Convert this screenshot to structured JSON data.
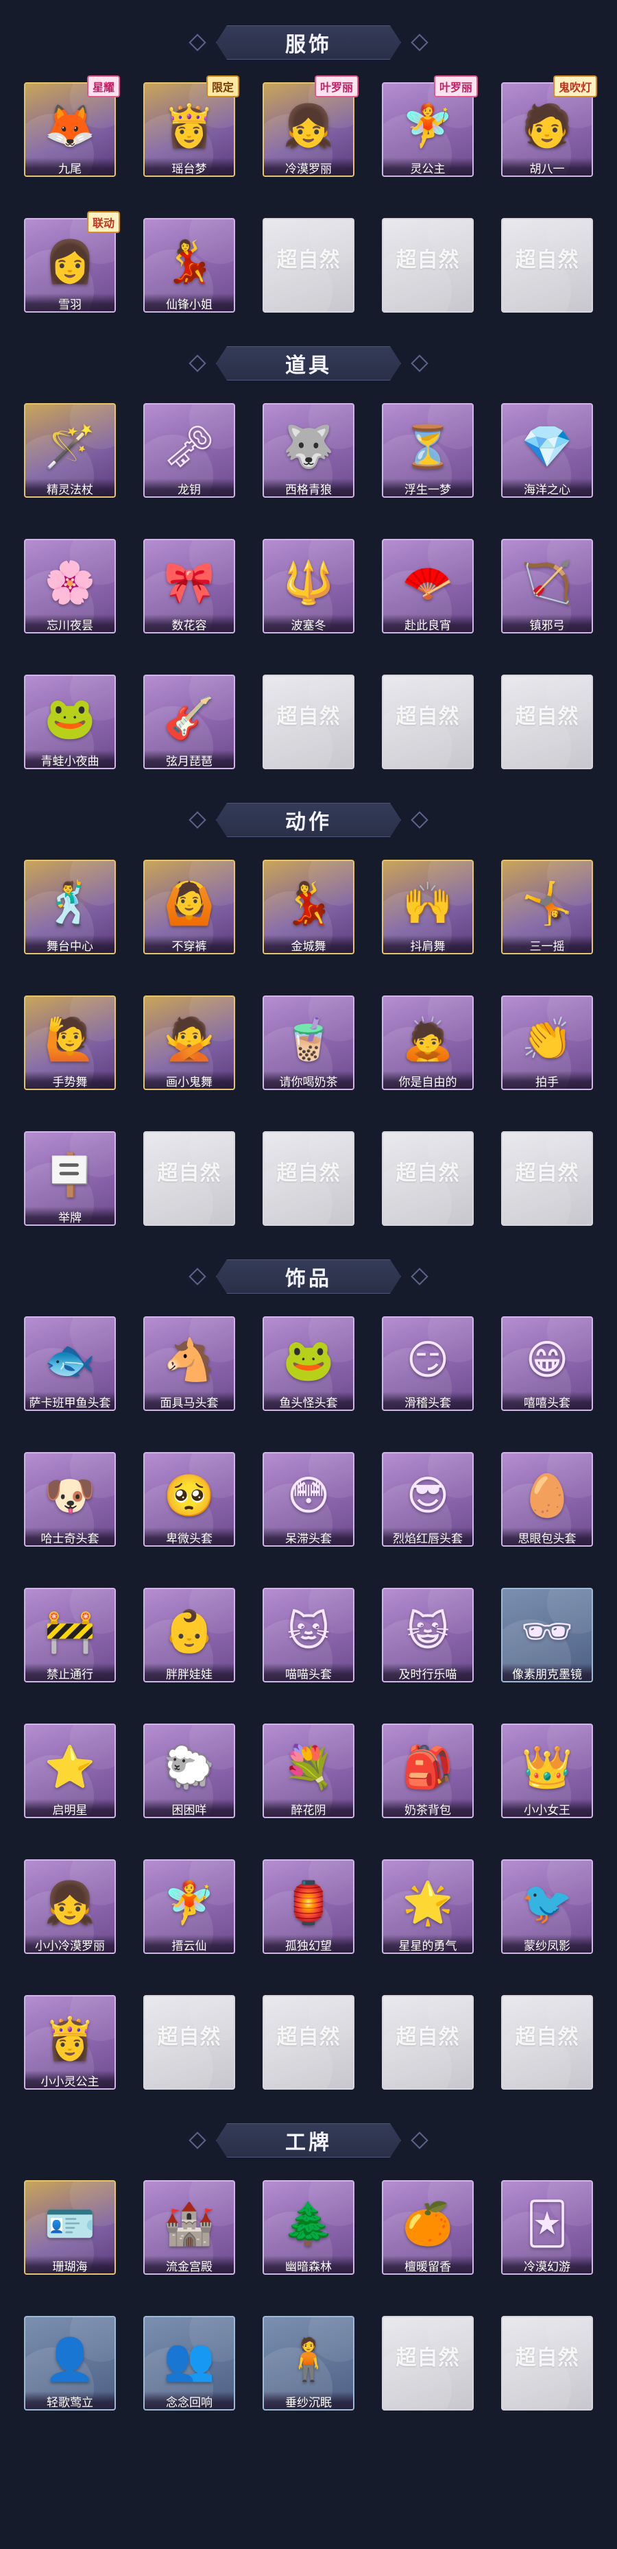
{
  "sections": [
    {
      "title": "服饰",
      "items": [
        {
          "label": "九尾",
          "icon": "fox-character-icon",
          "glyph": "🦊",
          "variant": "gold",
          "badge": "星耀",
          "badge_style": "rare"
        },
        {
          "label": "瑶台梦",
          "icon": "girl-character-icon",
          "glyph": "👸",
          "variant": "gold",
          "badge": "限定",
          "badge_style": "limited"
        },
        {
          "label": "冷漠罗丽",
          "icon": "girl-character-icon",
          "glyph": "👧",
          "variant": "gold",
          "badge": "叶罗丽",
          "badge_style": "rare"
        },
        {
          "label": "灵公主",
          "icon": "girl-character-icon",
          "glyph": "🧚",
          "variant": "purple",
          "badge": "叶罗丽",
          "badge_style": "rare"
        },
        {
          "label": "胡八一",
          "icon": "boy-character-icon",
          "glyph": "🧑",
          "variant": "purple",
          "badge": "鬼吹灯",
          "badge_style": "event"
        },
        {
          "label": "雪羽",
          "icon": "girl-character-icon",
          "glyph": "👩",
          "variant": "purple",
          "badge": "联动",
          "badge_style": "event"
        },
        {
          "label": "仙锋小姐",
          "icon": "girl-character-icon",
          "glyph": "💃",
          "variant": "purple",
          "badge": "",
          "badge_style": ""
        },
        {
          "label": "",
          "icon": "empty-slot-icon",
          "glyph": "",
          "variant": "empty",
          "empty_text": "超自然"
        },
        {
          "label": "",
          "icon": "empty-slot-icon",
          "glyph": "",
          "variant": "empty",
          "empty_text": "超自然"
        },
        {
          "label": "",
          "icon": "empty-slot-icon",
          "glyph": "",
          "variant": "empty",
          "empty_text": "超自然"
        }
      ]
    },
    {
      "title": "道具",
      "items": [
        {
          "label": "精灵法杖",
          "icon": "wand-icon",
          "glyph": "🪄",
          "variant": "gold"
        },
        {
          "label": "龙钥",
          "icon": "key-icon",
          "glyph": "🗝",
          "variant": "purple"
        },
        {
          "label": "西格青狼",
          "icon": "wolf-icon",
          "glyph": "🐺",
          "variant": "purple"
        },
        {
          "label": "浮生一梦",
          "icon": "hourglass-icon",
          "glyph": "⏳",
          "variant": "purple"
        },
        {
          "label": "海洋之心",
          "icon": "gem-necklace-icon",
          "glyph": "💎",
          "variant": "purple"
        },
        {
          "label": "忘川夜昙",
          "icon": "flower-icon",
          "glyph": "🌸",
          "variant": "purple"
        },
        {
          "label": "数花容",
          "icon": "ribbon-icon",
          "glyph": "🎀",
          "variant": "purple"
        },
        {
          "label": "波塞冬",
          "icon": "trident-icon",
          "glyph": "🔱",
          "variant": "purple"
        },
        {
          "label": "赴此良宵",
          "icon": "fan-icon",
          "glyph": "🪭",
          "variant": "purple"
        },
        {
          "label": "镇邪弓",
          "icon": "bow-icon",
          "glyph": "🏹",
          "variant": "purple"
        },
        {
          "label": "青蛙小夜曲",
          "icon": "frog-icon",
          "glyph": "🐸",
          "variant": "purple"
        },
        {
          "label": "弦月琵琶",
          "icon": "guitar-icon",
          "glyph": "🎸",
          "variant": "purple"
        },
        {
          "label": "",
          "icon": "empty-slot-icon",
          "glyph": "",
          "variant": "empty",
          "empty_text": "超自然"
        },
        {
          "label": "",
          "icon": "empty-slot-icon",
          "glyph": "",
          "variant": "empty",
          "empty_text": "超自然"
        },
        {
          "label": "",
          "icon": "empty-slot-icon",
          "glyph": "",
          "variant": "empty",
          "empty_text": "超自然"
        }
      ]
    },
    {
      "title": "动作",
      "items": [
        {
          "label": "舞台中心",
          "icon": "dance-pose-icon",
          "glyph": "🕺",
          "variant": "gold"
        },
        {
          "label": "不穿裤",
          "icon": "dance-pose-icon",
          "glyph": "🙆",
          "variant": "gold"
        },
        {
          "label": "金城舞",
          "icon": "dance-pose-icon",
          "glyph": "💃",
          "variant": "gold"
        },
        {
          "label": "抖肩舞",
          "icon": "dance-pose-icon",
          "glyph": "🙌",
          "variant": "gold"
        },
        {
          "label": "三一摇",
          "icon": "dance-pose-icon",
          "glyph": "🤸",
          "variant": "gold"
        },
        {
          "label": "手势舞",
          "icon": "dance-pose-icon",
          "glyph": "🙋",
          "variant": "gold"
        },
        {
          "label": "画小鬼舞",
          "icon": "dance-pose-icon",
          "glyph": "🙅",
          "variant": "gold"
        },
        {
          "label": "请你喝奶茶",
          "icon": "dance-pose-icon",
          "glyph": "🧋",
          "variant": "purple"
        },
        {
          "label": "你是自由的",
          "icon": "dance-pose-icon",
          "glyph": "🙇",
          "variant": "purple"
        },
        {
          "label": "拍手",
          "icon": "dance-pose-icon",
          "glyph": "👏",
          "variant": "purple"
        },
        {
          "label": "举牌",
          "icon": "sign-pose-icon",
          "glyph": "🪧",
          "variant": "purple"
        },
        {
          "label": "",
          "icon": "empty-slot-icon",
          "glyph": "",
          "variant": "empty",
          "empty_text": "超自然"
        },
        {
          "label": "",
          "icon": "empty-slot-icon",
          "glyph": "",
          "variant": "empty",
          "empty_text": "超自然"
        },
        {
          "label": "",
          "icon": "empty-slot-icon",
          "glyph": "",
          "variant": "empty",
          "empty_text": "超自然"
        },
        {
          "label": "",
          "icon": "empty-slot-icon",
          "glyph": "",
          "variant": "empty",
          "empty_text": "超自然"
        }
      ]
    },
    {
      "title": "饰品",
      "items": [
        {
          "label": "萨卡班甲鱼头套",
          "icon": "fish-head-icon",
          "glyph": "🐟",
          "variant": "purple"
        },
        {
          "label": "面具马头套",
          "icon": "horse-head-icon",
          "glyph": "🐴",
          "variant": "purple"
        },
        {
          "label": "鱼头怪头套",
          "icon": "fish-monster-icon",
          "glyph": "🐸",
          "variant": "purple"
        },
        {
          "label": "滑稽头套",
          "icon": "funny-face-icon",
          "glyph": "😏",
          "variant": "purple"
        },
        {
          "label": "嘻嘻头套",
          "icon": "grin-face-icon",
          "glyph": "😁",
          "variant": "purple"
        },
        {
          "label": "哈士奇头套",
          "icon": "husky-head-icon",
          "glyph": "🐶",
          "variant": "purple"
        },
        {
          "label": "卑微头套",
          "icon": "humble-face-icon",
          "glyph": "🥺",
          "variant": "purple"
        },
        {
          "label": "呆滞头套",
          "icon": "dazed-face-icon",
          "glyph": "😳",
          "variant": "purple"
        },
        {
          "label": "烈焰红唇头套",
          "icon": "pikachu-head-icon",
          "glyph": "😎",
          "variant": "purple"
        },
        {
          "label": "思眼包头套",
          "icon": "egg-face-icon",
          "glyph": "🥚",
          "variant": "purple"
        },
        {
          "label": "禁止通行",
          "icon": "traffic-cone-icon",
          "glyph": "🚧",
          "variant": "purple"
        },
        {
          "label": "胖胖娃娃",
          "icon": "doll-head-icon",
          "glyph": "👶",
          "variant": "purple"
        },
        {
          "label": "喵喵头套",
          "icon": "cat-head-icon",
          "glyph": "🐱",
          "variant": "purple"
        },
        {
          "label": "及时行乐喵",
          "icon": "cat-face-icon",
          "glyph": "😺",
          "variant": "purple"
        },
        {
          "label": "像素朋克墨镜",
          "icon": "pixel-sunglasses-icon",
          "glyph": "🕶",
          "variant": "blue"
        },
        {
          "label": "启明星",
          "icon": "star-headpiece-icon",
          "glyph": "⭐",
          "variant": "purple"
        },
        {
          "label": "困困咩",
          "icon": "sheep-icon",
          "glyph": "🐑",
          "variant": "purple"
        },
        {
          "label": "醉花阴",
          "icon": "flower-headpiece-icon",
          "glyph": "💐",
          "variant": "purple"
        },
        {
          "label": "奶茶背包",
          "icon": "backpack-icon",
          "glyph": "🎒",
          "variant": "purple"
        },
        {
          "label": "小小女王",
          "icon": "queen-doll-icon",
          "glyph": "👑",
          "variant": "purple"
        },
        {
          "label": "小小冷漠罗丽",
          "icon": "girl-doll-icon",
          "glyph": "👧",
          "variant": "purple"
        },
        {
          "label": "搢云仙",
          "icon": "fairy-charm-icon",
          "glyph": "🧚",
          "variant": "purple"
        },
        {
          "label": "孤独幻望",
          "icon": "lantern-charm-icon",
          "glyph": "🏮",
          "variant": "purple"
        },
        {
          "label": "星星的勇气",
          "icon": "star-charm-icon",
          "glyph": "🌟",
          "variant": "purple"
        },
        {
          "label": "蒙纱凤影",
          "icon": "phoenix-charm-icon",
          "glyph": "🐦",
          "variant": "purple"
        },
        {
          "label": "小小灵公主",
          "icon": "princess-doll-icon",
          "glyph": "👸",
          "variant": "purple"
        },
        {
          "label": "",
          "icon": "empty-slot-icon",
          "glyph": "",
          "variant": "empty",
          "empty_text": "超自然"
        },
        {
          "label": "",
          "icon": "empty-slot-icon",
          "glyph": "",
          "variant": "empty",
          "empty_text": "超自然"
        },
        {
          "label": "",
          "icon": "empty-slot-icon",
          "glyph": "",
          "variant": "empty",
          "empty_text": "超自然"
        },
        {
          "label": "",
          "icon": "empty-slot-icon",
          "glyph": "",
          "variant": "empty",
          "empty_text": "超自然"
        }
      ]
    },
    {
      "title": "工牌",
      "items": [
        {
          "label": "珊瑚海",
          "icon": "badge-card-icon",
          "glyph": "🪪",
          "variant": "gold"
        },
        {
          "label": "流金宫殿",
          "icon": "badge-card-icon",
          "glyph": "🏰",
          "variant": "purple"
        },
        {
          "label": "幽暗森林",
          "icon": "badge-card-icon",
          "glyph": "🌲",
          "variant": "purple"
        },
        {
          "label": "檀暖留香",
          "icon": "badge-card-icon",
          "glyph": "🍊",
          "variant": "purple"
        },
        {
          "label": "冷漠幻游",
          "icon": "badge-card-icon",
          "glyph": "🃏",
          "variant": "purple"
        },
        {
          "label": "轻歌莺立",
          "icon": "silhouette-card-icon",
          "glyph": "👤",
          "variant": "blue"
        },
        {
          "label": "念念回响",
          "icon": "silhouette-card-icon",
          "glyph": "👥",
          "variant": "blue"
        },
        {
          "label": "垂纱沉眠",
          "icon": "silhouette-card-icon",
          "glyph": "🧍",
          "variant": "blue"
        },
        {
          "label": "",
          "icon": "empty-slot-icon",
          "glyph": "",
          "variant": "empty",
          "empty_text": "超自然"
        },
        {
          "label": "",
          "icon": "empty-slot-icon",
          "glyph": "",
          "variant": "empty",
          "empty_text": "超自然"
        }
      ]
    }
  ]
}
